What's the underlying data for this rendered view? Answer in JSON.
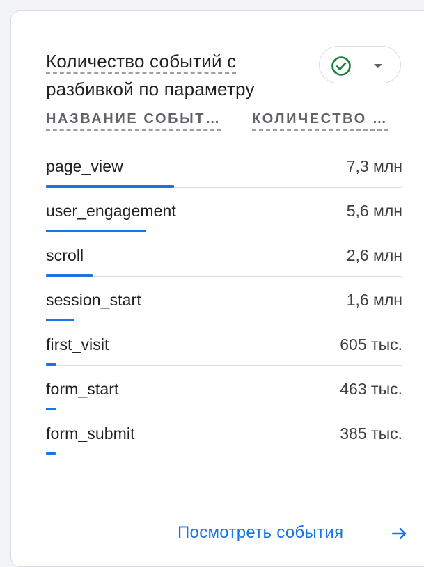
{
  "card": {
    "title_line1": "Количество событий с",
    "title_line2": "разбивкой по параметру",
    "status": {
      "icon": "check-circle-icon",
      "color": "#188038",
      "dropdown_icon": "caret-down-icon"
    },
    "columns": {
      "name": "НАЗВАНИЕ СОБЫТ…",
      "count": "КОЛИЧЕСТВО …"
    },
    "rows": [
      {
        "name": "page_view",
        "count": "7,3 млн",
        "share": 0.36
      },
      {
        "name": "user_engagement",
        "count": "5,6 млн",
        "share": 0.28
      },
      {
        "name": "scroll",
        "count": "2,6 млн",
        "share": 0.13
      },
      {
        "name": "session_start",
        "count": "1,6 млн",
        "share": 0.08
      },
      {
        "name": "first_visit",
        "count": "605 тыс.",
        "share": 0.03
      },
      {
        "name": "form_start",
        "count": "463 тыс.",
        "share": 0.02
      },
      {
        "name": "form_submit",
        "count": "385 тыс.",
        "share": 0.02
      }
    ],
    "footer_link": "Посмотреть события",
    "footer_icon": "arrow-right-icon",
    "accent_color": "#1a73e8"
  }
}
